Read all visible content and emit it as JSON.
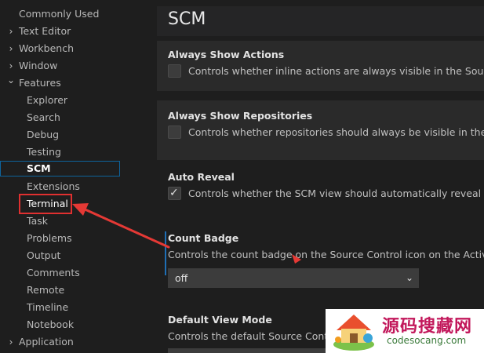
{
  "sidebar": {
    "items": [
      {
        "label": "Commonly Used",
        "level": "top",
        "chevron": ""
      },
      {
        "label": "Text Editor",
        "level": "top",
        "chevron": "›"
      },
      {
        "label": "Workbench",
        "level": "top",
        "chevron": "›"
      },
      {
        "label": "Window",
        "level": "top",
        "chevron": "›"
      },
      {
        "label": "Features",
        "level": "top",
        "chevron": "⌄"
      },
      {
        "label": "Explorer",
        "level": "child"
      },
      {
        "label": "Search",
        "level": "child"
      },
      {
        "label": "Debug",
        "level": "child"
      },
      {
        "label": "Testing",
        "level": "child"
      },
      {
        "label": "SCM",
        "level": "child",
        "selected": true
      },
      {
        "label": "Extensions",
        "level": "child"
      },
      {
        "label": "Terminal",
        "level": "child",
        "highlighted": true
      },
      {
        "label": "Task",
        "level": "child"
      },
      {
        "label": "Problems",
        "level": "child"
      },
      {
        "label": "Output",
        "level": "child"
      },
      {
        "label": "Comments",
        "level": "child"
      },
      {
        "label": "Remote",
        "level": "child"
      },
      {
        "label": "Timeline",
        "level": "child"
      },
      {
        "label": "Notebook",
        "level": "child"
      },
      {
        "label": "Application",
        "level": "top",
        "chevron": "›"
      }
    ]
  },
  "main": {
    "title": "SCM",
    "settings": [
      {
        "title": "Always Show Actions",
        "description": "Controls whether inline actions are always visible in the Source Co",
        "checked": false
      },
      {
        "title": "Always Show Repositories",
        "description": "Controls whether repositories should always be visible in the SCM",
        "checked": false
      },
      {
        "title": "Auto Reveal",
        "description": "Controls whether the SCM view should automatically reveal and s",
        "checked": true
      },
      {
        "title": "Count Badge",
        "description": "Controls the count badge on the Source Control icon on the Activity Ba",
        "value": "off"
      },
      {
        "title": "Default View Mode",
        "description": "Controls the default Source Control"
      }
    ]
  },
  "watermark": {
    "text_cn": "源码搜藏网",
    "text_en": "codesocang.com"
  },
  "colors": {
    "accent": "#1f6fb5",
    "highlight_border": "#e03030",
    "arrow": "#e53935"
  }
}
